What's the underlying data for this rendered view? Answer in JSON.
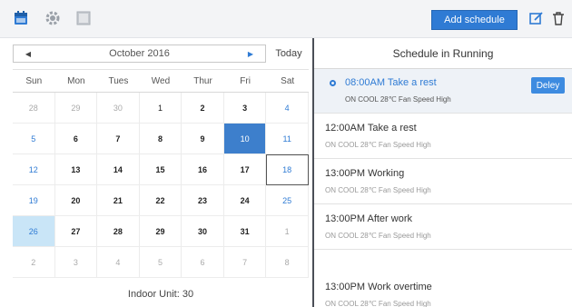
{
  "toolbar": {
    "add_schedule_label": "Add schedule",
    "icons": [
      "calendar-icon",
      "settings-icon",
      "grid-icon",
      "edit-icon",
      "trash-icon"
    ],
    "accent": "#2f7bd4"
  },
  "calendar": {
    "title": "October 2016",
    "today_label": "Today",
    "weekdays": [
      "Sun",
      "Mon",
      "Tues",
      "Wed",
      "Thur",
      "Fri",
      "Sat"
    ],
    "weeks": [
      [
        "28",
        "29",
        "30",
        "1",
        "2",
        "3",
        "4"
      ],
      [
        "5",
        "6",
        "7",
        "8",
        "9",
        "10",
        "11"
      ],
      [
        "12",
        "13",
        "14",
        "15",
        "16",
        "17",
        "18"
      ],
      [
        "19",
        "20",
        "21",
        "22",
        "23",
        "24",
        "25"
      ],
      [
        "26",
        "27",
        "28",
        "29",
        "30",
        "31",
        "1"
      ],
      [
        "2",
        "3",
        "4",
        "5",
        "6",
        "7",
        "8"
      ]
    ],
    "footer": "Indoor Unit: 30"
  },
  "schedule": {
    "title": "Schedule in Running",
    "delete_label": "Deley",
    "items": [
      {
        "time": "08:00AM Take a rest",
        "meta": "ON    COOL 28℃    Fan Speed High"
      },
      {
        "time": "12:00AM Take a rest",
        "meta": "ON    COOL 28℃    Fan Speed High"
      },
      {
        "time": "13:00PM Working",
        "meta": "ON    COOL 28℃    Fan Speed High"
      },
      {
        "time": "13:00PM After work",
        "meta": "ON    COOL 28℃    Fan Speed High"
      },
      {
        "time": "13:00PM Work overtime",
        "meta": "ON    COOL 28℃    Fan Speed High"
      }
    ]
  }
}
